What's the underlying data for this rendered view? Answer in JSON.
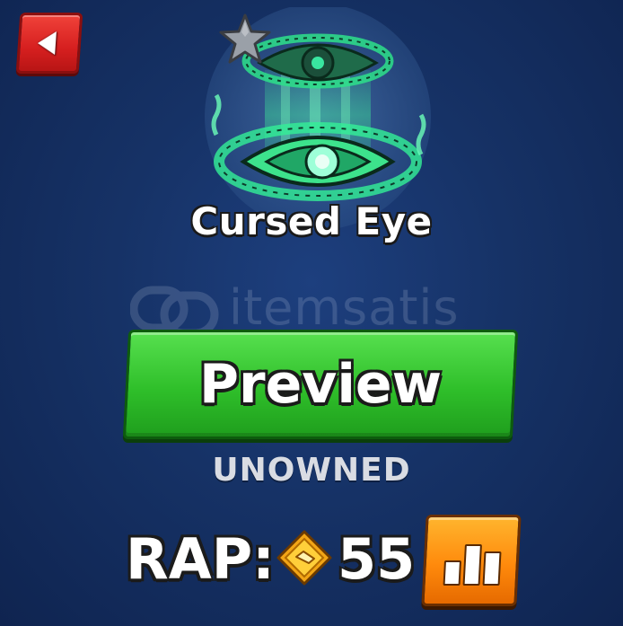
{
  "item": {
    "name": "Cursed Eye",
    "icon": "cursed-eye-icon",
    "rarity_icon": "star-icon"
  },
  "buttons": {
    "back_icon": "back-arrow-icon",
    "preview_label": "Preview",
    "stats_icon": "bar-chart-icon"
  },
  "status": {
    "ownership": "UNOWNED"
  },
  "rap": {
    "label": "RAP:",
    "currency_icon": "diamond-coin-icon",
    "value": "55"
  },
  "watermark": {
    "text": "itemsatis"
  },
  "colors": {
    "background": "#163266",
    "preview_button": "#2fbf2a",
    "back_button": "#d61f1f",
    "stats_button": "#ff8a0c",
    "item_glow": "#3dff9a"
  }
}
